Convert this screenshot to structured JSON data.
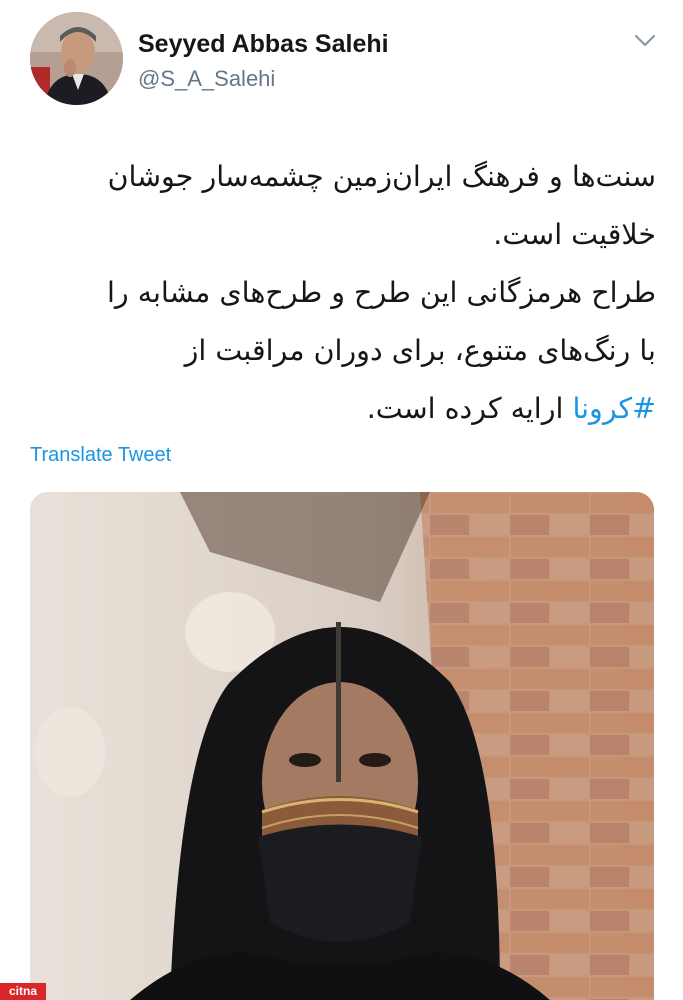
{
  "tweet": {
    "author": {
      "name": "Seyyed Abbas Salehi",
      "handle": "@S_A_Salehi"
    },
    "text": {
      "line1": "سنت‌ها و فرهنگ ایران‌زمین چشمه‌سار جوشان",
      "line2": "خلاقیت است.",
      "line3": "طراح هرمزگانی این طرح و طرح‌های مشابه را",
      "line4": "با رنگ‌های متنوع، برای دوران مراقبت از",
      "line5_hashtag": "#کرونا",
      "line5_rest": " ارایه کرده است."
    },
    "translate_label": "Translate Tweet"
  },
  "watermark": "citna",
  "icons": {
    "menu": "chevron-down-icon"
  },
  "colors": {
    "link": "#1b95e0",
    "secondary_text": "#657786",
    "watermark_bg": "#d8262b"
  }
}
